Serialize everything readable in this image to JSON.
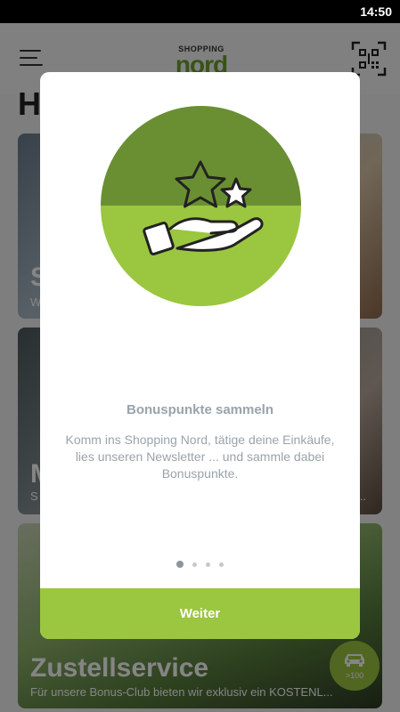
{
  "status_bar": {
    "time": "14:50"
  },
  "header": {
    "logo_line1": "SHOPPING",
    "logo_line2": "nord",
    "page_title": "H"
  },
  "cards": [
    {
      "title": "S",
      "subtitle": "W"
    },
    {
      "title": "M",
      "subtitle": "S",
      "subtitle_end": "..."
    },
    {
      "title": "Zustellservice",
      "subtitle": "Für unsere Bonus-Club bieten wir exklusiv ein KOSTENL..."
    }
  ],
  "fab": {
    "label": ">100",
    "icon": "car-icon"
  },
  "modal": {
    "title": "Bonuspunkte sammeln",
    "text": "Komm ins Shopping Nord, tätige deine Einkäufe, lies unseren Newsletter ... und sammle dabei Bonuspunkte.",
    "button_label": "Weiter",
    "pager": {
      "total": 4,
      "active": 1
    },
    "hero_icon": "hand-with-stars-icon"
  },
  "colors": {
    "accent_green": "#9bc640",
    "dark_green": "#6a8f32",
    "brand_green": "#6e9f2c",
    "text_gray": "#9aa3ab"
  }
}
